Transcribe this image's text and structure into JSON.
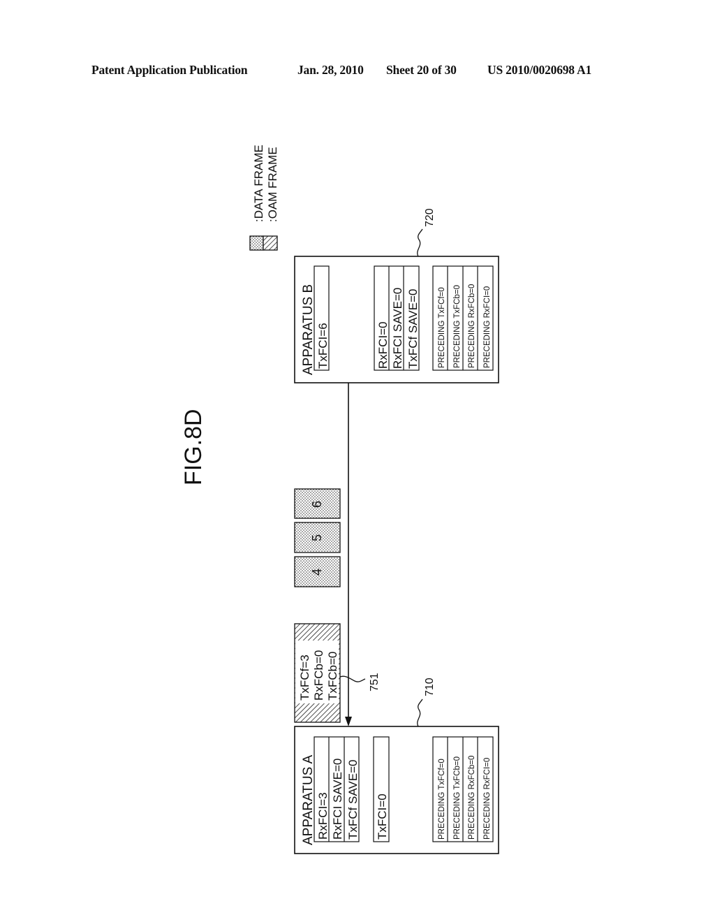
{
  "header": {
    "publication": "Patent Application Publication",
    "date": "Jan. 28, 2010",
    "sheet": "Sheet 20 of 30",
    "number": "US 2010/0020698 A1"
  },
  "figure": {
    "title": "FIG.8D",
    "legend": [
      {
        "pattern": "dotted",
        "label": ":DATA FRAME"
      },
      {
        "pattern": "hatched",
        "label": ":OAM FRAME"
      }
    ],
    "apparatus_b": {
      "ref": "720",
      "title": "APPARATUS B",
      "group1": [
        "TxFCI=6"
      ],
      "group2": [
        "RxFCI=0",
        "RxFCI SAVE=0",
        "TxFCf SAVE=0"
      ],
      "group3": [
        "PRECEDING TxFCf=0",
        "PRECEDING TxFCb=0",
        "PRECEDING RxFCb=0",
        "PRECEDING RxFCI=0"
      ]
    },
    "apparatus_a": {
      "ref": "710",
      "title": "APPARATUS A",
      "group1": [
        "RxFCI=3",
        "RxFCI SAVE=0",
        "TxFCf SAVE=0"
      ],
      "group2": [
        "TxFCI=0"
      ],
      "group3": [
        "PRECEDING TxFCf=0",
        "PRECEDING TxFCb=0",
        "PRECEDING RxFCb=0",
        "PRECEDING RxFCI=0"
      ]
    },
    "oam_frame": {
      "ref": "751",
      "lines": [
        "TxFCf=3",
        "RxFCb=0",
        "TxFCb=0"
      ]
    },
    "data_frames": [
      "4",
      "5",
      "6"
    ]
  }
}
